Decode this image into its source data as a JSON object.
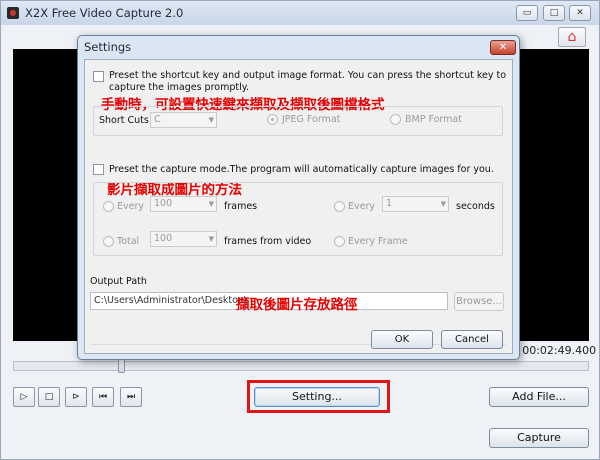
{
  "app": {
    "title": "X2X Free Video Capture 2.0"
  },
  "window_controls": {
    "minimize": "▭",
    "maximize": "□",
    "close": "✕"
  },
  "player": {
    "time": "/ 00:02:49.400",
    "seek_progress": 0.19
  },
  "controls": {
    "play": "▷",
    "stop": "□",
    "step": "⊳",
    "prev": "⏮",
    "next": "⏭",
    "setting_label": "Setting...",
    "add_file_label": "Add File...",
    "capture_label": "Capture"
  },
  "dialog": {
    "title": "Settings",
    "close": "✕",
    "shortcut": {
      "description": "Preset the shortcut key and output image format. You can press the shortcut key to capture the images promptly.",
      "note": "手動時，可設置快速鍵來擷取及擷取後圖檔格式",
      "shortcut_label": "Short Cuts",
      "shortcut_value": "C",
      "jpeg_label": "JPEG Format",
      "bmp_label": "BMP Format"
    },
    "capture_mode": {
      "description": "Preset the capture mode.The program will automatically capture images for you.",
      "note": "影片擷取成圖片的方法",
      "every_label": "Every",
      "every_frames_value": "100",
      "frames_label": "frames",
      "every_seconds_label": "Every",
      "every_seconds_value": "1",
      "seconds_label": "seconds",
      "total_label": "Total",
      "total_value": "100",
      "frames_from_video_label": "frames from video",
      "every_frame_label": "Every Frame"
    },
    "output": {
      "label": "Output Path",
      "path": "C:\\Users\\Administrator\\Desktop\\",
      "note": "擷取後圖片存放路徑",
      "browse_label": "Browse..."
    },
    "ok_label": "OK",
    "cancel_label": "Cancel"
  },
  "colors": {
    "highlight": "#e31414",
    "note": "#e60000"
  }
}
